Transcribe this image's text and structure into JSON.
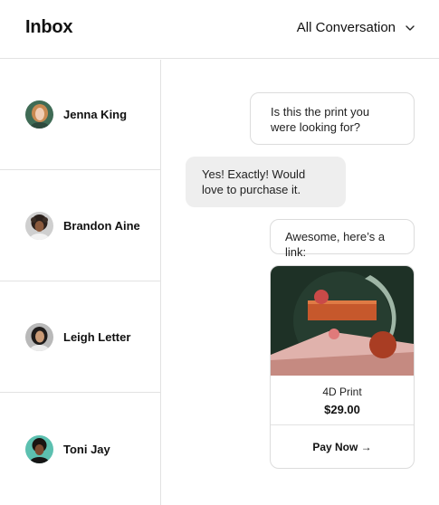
{
  "header": {
    "title": "Inbox",
    "filter_label": "All Conversation",
    "filter_icon": "chevron-down-icon"
  },
  "contacts": [
    {
      "name": "Jenna King",
      "avatar_color": "#3f6b55"
    },
    {
      "name": "Brandon Aine",
      "avatar_color": "#cfcfcf"
    },
    {
      "name": "Leigh Letter",
      "avatar_color": "#b9b9b9"
    },
    {
      "name": "Toni Jay",
      "avatar_color": "#5cc0b0"
    }
  ],
  "messages": [
    {
      "direction": "outgoing",
      "text": "Is this the print you were looking for?"
    },
    {
      "direction": "incoming",
      "text": "Yes! Exactly! Would love to purchase it."
    },
    {
      "direction": "outgoing",
      "text": "Awesome, here’s a link:"
    }
  ],
  "product": {
    "name": "4D Print",
    "price": "$29.00",
    "cta": "Pay Now →"
  }
}
